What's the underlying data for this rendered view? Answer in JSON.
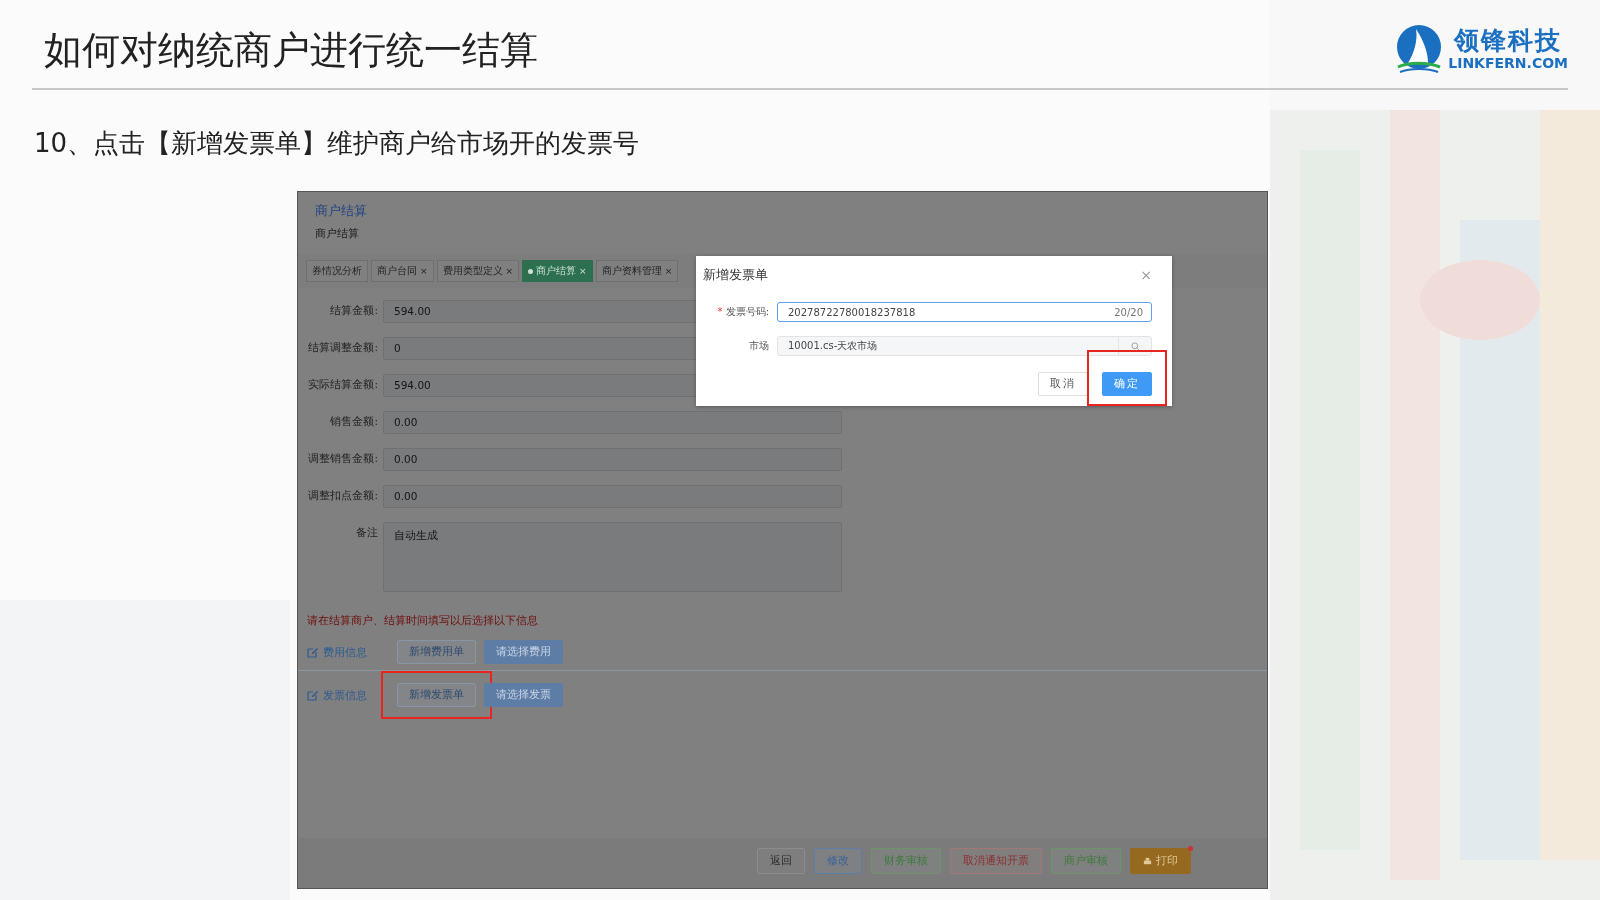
{
  "slide": {
    "title": "如何对纳统商户进行统一结算",
    "step": "10、点击【新增发票单】维护商户给市场开的发票号",
    "logo": {
      "name": "领锋科技",
      "site": "LINKFERN.COM"
    }
  },
  "app": {
    "breadcrumb": "商户结算",
    "page_title": "商户结算",
    "tabs": [
      {
        "label": "券情况分析",
        "selected": false
      },
      {
        "label": "商户台同",
        "close": "×",
        "selected": false
      },
      {
        "label": "费用类型定义",
        "close": "×",
        "selected": false
      },
      {
        "label": "商户结算",
        "close": "×",
        "selected": true
      },
      {
        "label": "商户资料管理",
        "close": "×",
        "selected": false
      }
    ],
    "fields": [
      {
        "label": "结算金额:",
        "value": "594.00",
        "kind": "input"
      },
      {
        "label": "结算调整金额:",
        "value": "0",
        "kind": "input"
      },
      {
        "label": "实际结算金额:",
        "value": "594.00",
        "kind": "input"
      },
      {
        "label": "销售金额:",
        "value": "0.00",
        "kind": "input"
      },
      {
        "label": "调整销售金额:",
        "value": "0.00",
        "kind": "input"
      },
      {
        "label": "调整扣点金额:",
        "value": "0.00",
        "kind": "input"
      },
      {
        "label": "备注",
        "value": "自动生成",
        "kind": "textarea"
      }
    ],
    "hint": "请在结算商户、结算时间填写以后选择以下信息",
    "sections": [
      {
        "title": "费用信息",
        "buttons": [
          {
            "label": "新增费用单",
            "kind": "plain"
          },
          {
            "label": "请选择费用",
            "kind": "primary"
          }
        ]
      },
      {
        "title": "发票信息",
        "buttons": [
          {
            "label": "新增发票单",
            "kind": "plain",
            "highlighted": true
          },
          {
            "label": "请选择发票",
            "kind": "primary"
          }
        ]
      }
    ],
    "footer_buttons": [
      {
        "label": "返回",
        "kind": "default"
      },
      {
        "label": "修改",
        "kind": "blue"
      },
      {
        "label": "财务审核",
        "kind": "green"
      },
      {
        "label": "取消通知开票",
        "kind": "red"
      },
      {
        "label": "商户审核",
        "kind": "green"
      },
      {
        "label": "打印",
        "kind": "print"
      }
    ]
  },
  "dialog": {
    "title": "新增发票单",
    "close": "×",
    "fields": [
      {
        "label": "发票号码:",
        "required_mark": "*",
        "value": "20278722780018237818",
        "count": "20/20",
        "kind": "text"
      },
      {
        "label": "市场",
        "value": "10001.cs-天农市场",
        "kind": "lookup"
      }
    ],
    "buttons": [
      {
        "label": "取消",
        "kind": "default"
      },
      {
        "label": "确定",
        "kind": "primary",
        "highlighted": true
      }
    ]
  }
}
